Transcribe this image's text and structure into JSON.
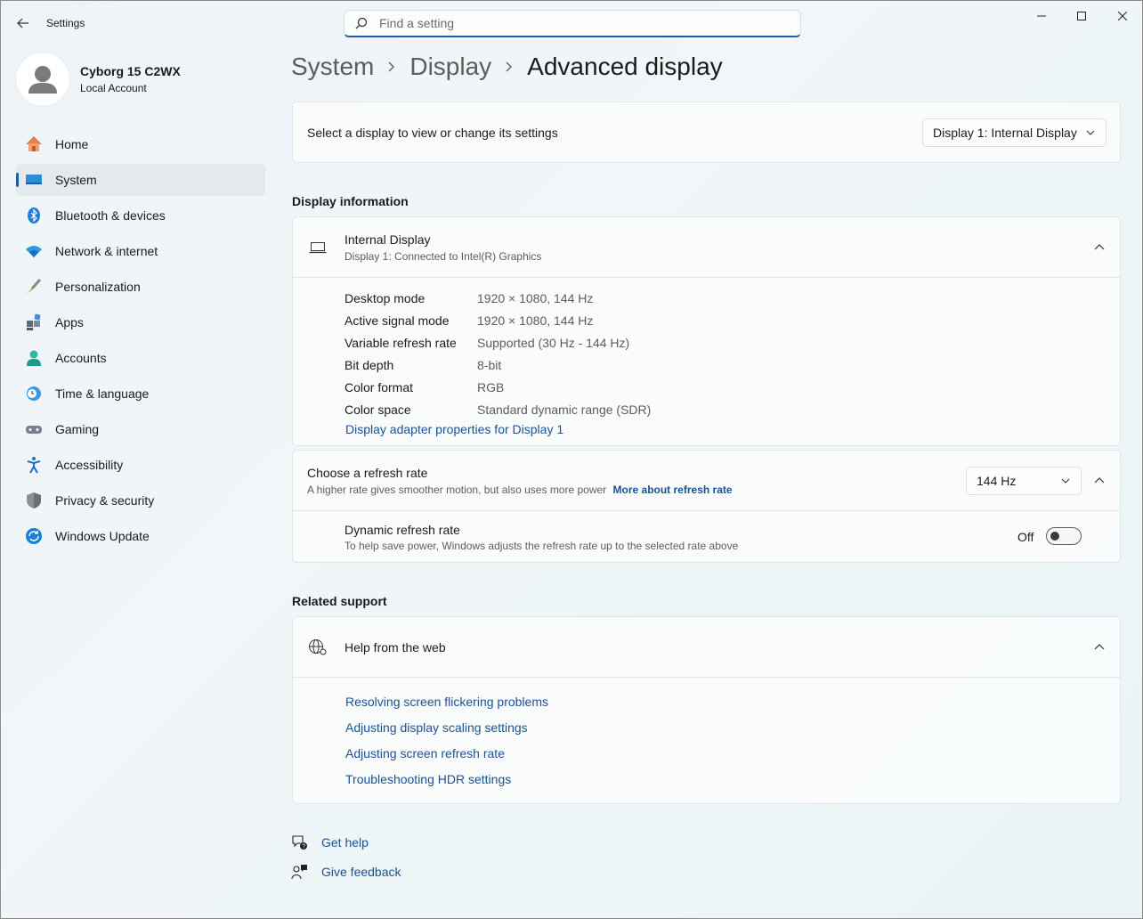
{
  "window": {
    "title": "Settings"
  },
  "search": {
    "placeholder": "Find a setting"
  },
  "profile": {
    "name": "Cyborg 15 C2WX",
    "account_type": "Local Account"
  },
  "sidebar": {
    "items": [
      {
        "label": "Home",
        "icon": "home-icon"
      },
      {
        "label": "System",
        "icon": "system-icon",
        "active": true
      },
      {
        "label": "Bluetooth & devices",
        "icon": "bluetooth-icon"
      },
      {
        "label": "Network & internet",
        "icon": "wifi-icon"
      },
      {
        "label": "Personalization",
        "icon": "brush-icon"
      },
      {
        "label": "Apps",
        "icon": "apps-icon"
      },
      {
        "label": "Accounts",
        "icon": "accounts-icon"
      },
      {
        "label": "Time & language",
        "icon": "clock-globe-icon"
      },
      {
        "label": "Gaming",
        "icon": "gamepad-icon"
      },
      {
        "label": "Accessibility",
        "icon": "accessibility-icon"
      },
      {
        "label": "Privacy & security",
        "icon": "shield-icon"
      },
      {
        "label": "Windows Update",
        "icon": "update-icon"
      }
    ]
  },
  "breadcrumb": {
    "items": [
      "System",
      "Display",
      "Advanced display"
    ]
  },
  "display_select": {
    "label": "Select a display to view or change its settings",
    "value": "Display 1: Internal Display"
  },
  "display_info": {
    "section_title": "Display information",
    "header_title": "Internal Display",
    "header_subtitle": "Display 1: Connected to Intel(R) Graphics",
    "rows": [
      {
        "key": "Desktop mode",
        "value": "1920 × 1080, 144 Hz"
      },
      {
        "key": "Active signal mode",
        "value": "1920 × 1080, 144 Hz"
      },
      {
        "key": "Variable refresh rate",
        "value": "Supported (30 Hz - 144 Hz)"
      },
      {
        "key": "Bit depth",
        "value": "8-bit"
      },
      {
        "key": "Color format",
        "value": "RGB"
      },
      {
        "key": "Color space",
        "value": "Standard dynamic range (SDR)"
      }
    ],
    "adapter_link": "Display adapter properties for Display 1"
  },
  "refresh": {
    "title": "Choose a refresh rate",
    "subtitle": "A higher rate gives smoother motion, but also uses more power",
    "more_link": "More about refresh rate",
    "value": "144 Hz",
    "dynamic_title": "Dynamic refresh rate",
    "dynamic_subtitle": "To help save power, Windows adjusts the refresh rate up to the selected rate above",
    "dynamic_state": "Off"
  },
  "related": {
    "section_title": "Related support",
    "help_title": "Help from the web",
    "links": [
      "Resolving screen flickering problems",
      "Adjusting display scaling settings",
      "Adjusting screen refresh rate",
      "Troubleshooting HDR settings"
    ]
  },
  "footer": {
    "get_help": "Get help",
    "give_feedback": "Give feedback"
  },
  "colors": {
    "accent": "#1a5fa8",
    "link": "#1a5196"
  }
}
